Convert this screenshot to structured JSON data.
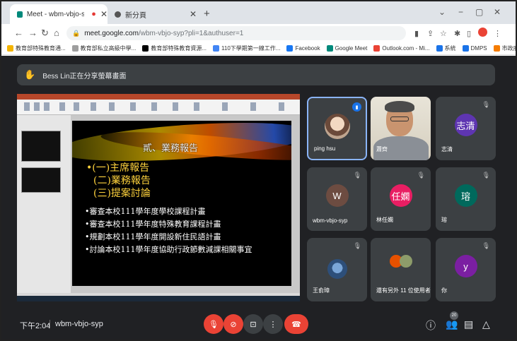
{
  "browser": {
    "tabs": [
      {
        "title": "Meet - wbm-vbjo-syp",
        "recording": true
      },
      {
        "title": "新分頁",
        "recording": false
      }
    ],
    "new_tab": "+",
    "window_controls": {
      "min": "−",
      "max": "▢",
      "close": "✕",
      "menu": "⌄"
    },
    "url_host": "meet.google.com",
    "url_rest": "/wbm-vbjo-syp?pli=1&authuser=1",
    "bookmarks": [
      {
        "label": "教育部特殊教育通...",
        "color": "#f4b400"
      },
      {
        "label": "教育部私立高級中學...",
        "color": "#9e9e9e"
      },
      {
        "label": "教育部特殊教育資源...",
        "color": "#000000"
      },
      {
        "label": "110下學期第一線工作...",
        "color": "#4285f4"
      },
      {
        "label": "Facebook",
        "color": "#1877f2"
      },
      {
        "label": "Google Meet",
        "color": "#00897b"
      },
      {
        "label": "Outlook.com - Mi...",
        "color": "#ea4335"
      },
      {
        "label": "系統",
        "color": "#1a73e8"
      },
      {
        "label": "DMPS",
        "color": "#1a73e8"
      },
      {
        "label": "市政府教育局...",
        "color": "#f57c00"
      }
    ]
  },
  "meet": {
    "presenter_text": "Bess Lin正在分享螢幕畫面",
    "slide": {
      "heading": "貳、業務報告",
      "agenda": [
        "•(一)主席報告",
        "(二)業務報告",
        "(三)提案討論"
      ],
      "plans": [
        "•審查本校111學年度學校課程計畫",
        "•審查本校111學年度特殊教育課程計畫",
        "•規劃本校111學年度開設新住民語計畫",
        "•討論本校111學年度協助行政節數減課相關事宜"
      ]
    },
    "tiles": [
      {
        "name": "ping hsu",
        "avatar": "",
        "color": "",
        "type": "photo",
        "speaking": true
      },
      {
        "name": "蕭齊",
        "avatar": "",
        "color": "",
        "type": "video",
        "speaking": false
      },
      {
        "name": "志清",
        "avatar": "志清",
        "color": "#5e35b1",
        "type": "letter",
        "speaking": false
      },
      {
        "name": "wbm-vbjo-syp",
        "avatar": "W",
        "color": "#6d4c41",
        "type": "letter",
        "speaking": false
      },
      {
        "name": "林任嫻",
        "avatar": "任嫻",
        "color": "#e91e63",
        "type": "letter",
        "speaking": false
      },
      {
        "name": "瑢",
        "avatar": "瑢",
        "color": "#00695c",
        "type": "letter",
        "speaking": false
      },
      {
        "name": "王俞璋",
        "avatar": "",
        "color": "",
        "type": "photo2",
        "speaking": false
      },
      {
        "name": "還有另外 11 位使用者",
        "avatar": "",
        "color": "",
        "type": "group",
        "speaking": false
      },
      {
        "name": "你",
        "avatar": "y",
        "color": "#7b1fa2",
        "type": "letter",
        "speaking": false
      }
    ],
    "clock": "下午2:04",
    "meeting_code": "wbm-vbjo-syp",
    "participant_count": "20",
    "icons": {
      "mic_off": "mic-off-icon",
      "cam_off": "camera-off-icon",
      "present": "present-icon",
      "more": "more-icon",
      "hangup": "hangup-icon"
    }
  }
}
